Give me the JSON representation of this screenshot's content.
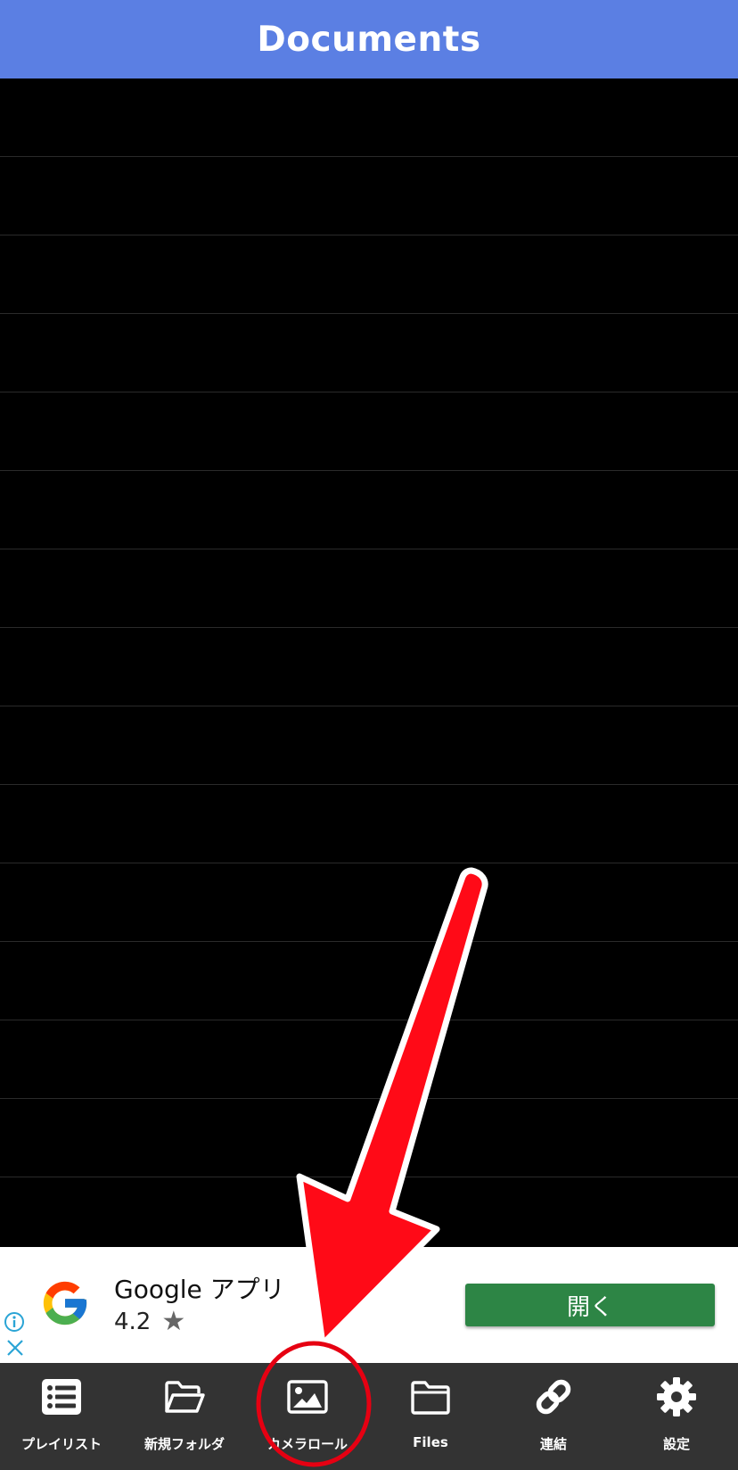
{
  "header": {
    "title": "Documents"
  },
  "list": {
    "row_count": 15
  },
  "ad": {
    "app_name": "Google アプリ",
    "rating": "4.2",
    "open_button_label": "開く",
    "logo_icon": "google-g-icon",
    "info_icon": "info-icon",
    "close_icon": "close-icon"
  },
  "tabbar": {
    "tabs": [
      {
        "label": "プレイリスト",
        "icon": "list-icon"
      },
      {
        "label": "新規フォルダ",
        "icon": "folder-open-icon"
      },
      {
        "label": "カメラロール",
        "icon": "image-icon"
      },
      {
        "label": "Files",
        "icon": "folder-icon"
      },
      {
        "label": "連結",
        "icon": "link-icon"
      },
      {
        "label": "設定",
        "icon": "gear-icon"
      }
    ]
  },
  "annotation": {
    "arrow_color": "#ff0a17",
    "circle_color": "#e60012",
    "target": "カメラロール"
  },
  "colors": {
    "header": "#5b7fe3",
    "tabbar": "#333333",
    "open_button": "#2d8545"
  }
}
